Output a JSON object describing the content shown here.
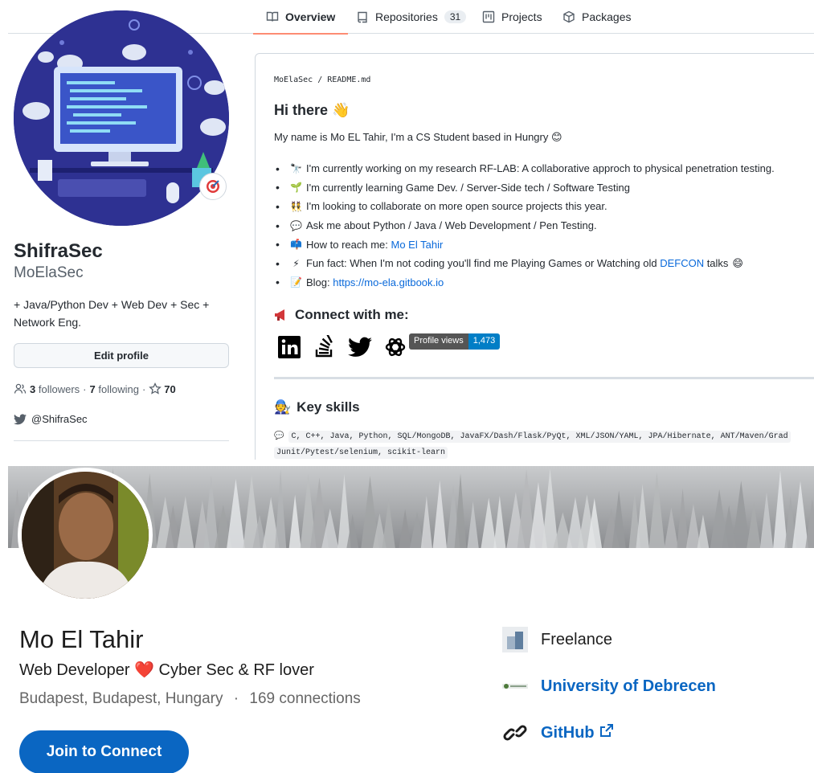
{
  "github": {
    "tabs": [
      {
        "label": "Overview"
      },
      {
        "label": "Repositories",
        "count": "31"
      },
      {
        "label": "Projects"
      },
      {
        "label": "Packages"
      }
    ],
    "profile": {
      "name": "ShifraSec",
      "login": "MoElaSec",
      "bio": "+ Java/Python Dev + Web Dev + Sec + Network Eng.",
      "edit_label": "Edit profile",
      "followers_count": "3",
      "followers_label": "followers",
      "following_count": "7",
      "following_label": "following",
      "stars": "70",
      "twitter": "@ShifraSec"
    },
    "readme": {
      "path_user": "MoElaSec",
      "path_sep": " / ",
      "path_file": "README.md",
      "heading": "Hi there",
      "intro": "My name is Mo EL Tahir, I'm a CS Student based in Hungry",
      "items": [
        {
          "emoji": "🔭",
          "text": "I'm currently working on my research RF-LAB: A collaborative approch to physical penetration testing."
        },
        {
          "emoji": "🌱",
          "text": "I'm currently learning Game Dev. / Server-Side tech / Software Testing"
        },
        {
          "emoji": "👯",
          "text": "I'm looking to collaborate on more open source projects this year."
        },
        {
          "emoji": "💬",
          "text": "Ask me about Python / Java / Web Development / Pen Testing."
        },
        {
          "emoji": "📫",
          "text": "How to reach me: ",
          "link": "Mo El Tahir"
        },
        {
          "emoji": "⚡",
          "text": "Fun fact: When I'm not coding you'll find me Playing Games or Watching old ",
          "link": "DEFCON",
          "after": " talks"
        },
        {
          "emoji": "📝",
          "text": "Blog: ",
          "link": "https://mo-ela.gitbook.io"
        }
      ],
      "connect_heading": "Connect with me:",
      "badge_label": "Profile views",
      "badge_value": "1,473",
      "skills_heading": "Key skills",
      "skills_line1": "C, C++, Java, Python, SQL/MongoDB, JavaFX/Dash/Flask/PyQt, XML/JSON/YAML, JPA/Hibernate, ANT/Maven/Grad",
      "skills_line2": "Junit/Pytest/selenium, scikit-learn"
    }
  },
  "linkedin": {
    "name": "Mo El Tahir",
    "headline_pre": "Web Developer",
    "headline_post": "Cyber Sec & RF lover",
    "location": "Budapest, Budapest, Hungary",
    "dot": "·",
    "connections": "169 connections",
    "join_label": "Join to Connect",
    "side": [
      {
        "label": "Freelance",
        "style": "plain"
      },
      {
        "label": "University of Debrecen",
        "style": "link"
      },
      {
        "label": "GitHub",
        "style": "link"
      }
    ]
  },
  "colors": {
    "github_accent": "#fd8c73",
    "github_link": "#0969da",
    "badge_blue": "#007ec6",
    "linkedin_blue": "#0a66c2"
  }
}
